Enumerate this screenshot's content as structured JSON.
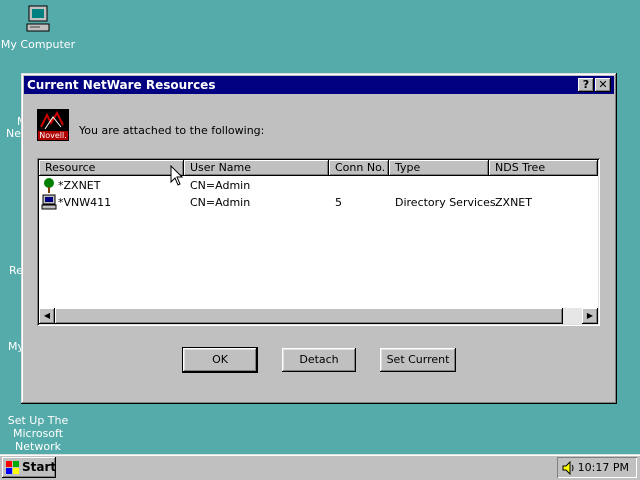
{
  "desktop": {
    "icons": [
      {
        "label": "My Computer",
        "icon": "my-computer-icon"
      },
      {
        "label": "Set Up The Microsoft Network",
        "icon": "msn-setup-icon"
      }
    ],
    "partial_labels": [
      "M",
      "Nei",
      "Re",
      "My"
    ]
  },
  "window": {
    "title": "Current NetWare Resources",
    "help_glyph": "?",
    "close_glyph": "✕",
    "logo_text": "Novell.",
    "message": "You are attached to the following:"
  },
  "list": {
    "columns": [
      "Resource",
      "User Name",
      "Conn No.",
      "Type",
      "NDS Tree"
    ],
    "rows": [
      {
        "icon": "tree-icon",
        "resource": "*ZXNET",
        "user": "CN=Admin",
        "conn": "",
        "type": "",
        "tree": ""
      },
      {
        "icon": "server-icon",
        "resource": "*VNW411",
        "user": "CN=Admin",
        "conn": "5",
        "type": "Directory Services",
        "tree": "ZXNET"
      }
    ]
  },
  "buttons": {
    "ok": "OK",
    "detach": "Detach",
    "set_current": "Set Current"
  },
  "taskbar": {
    "start": "Start",
    "time": "10:17 PM"
  }
}
